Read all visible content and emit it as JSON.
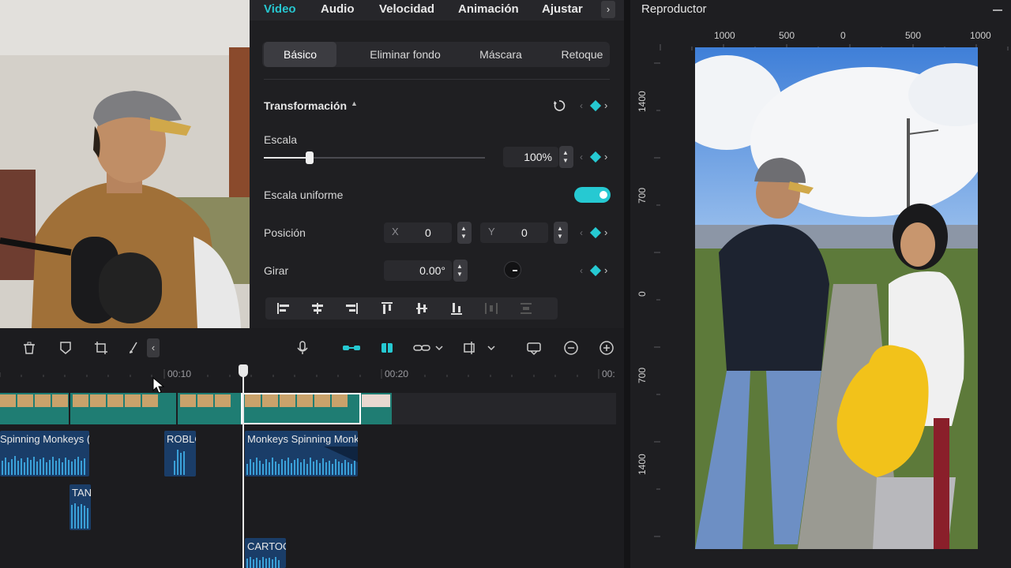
{
  "props": {
    "tabs": [
      "Video",
      "Audio",
      "Velocidad",
      "Animación",
      "Ajustar"
    ],
    "active_tab": "Video",
    "subtabs": [
      "Básico",
      "Eliminar fondo",
      "Máscara",
      "Retoque"
    ],
    "transform_title": "Transformación",
    "scale_label": "Escala",
    "scale_value": "100%",
    "uniform_label": "Escala uniforme",
    "position_label": "Posición",
    "pos_x_label": "X",
    "pos_x_value": "0",
    "pos_y_label": "Y",
    "pos_y_value": "0",
    "rotate_label": "Girar",
    "rotate_value": "0.00°",
    "accent_color": "#26c9d2"
  },
  "player": {
    "title": "Reproductor",
    "ruler_top": [
      "1000",
      "500",
      "0",
      "500",
      "1000"
    ],
    "ruler_left": [
      "1400",
      "700",
      "0",
      "700",
      "1400"
    ]
  },
  "timeline": {
    "timecodes": [
      "00:10",
      "00:20",
      "00:"
    ],
    "clips": [
      {
        "label": "Spinning Monkeys (I"
      },
      {
        "label": "ROBLO"
      },
      {
        "label": "Monkeys Spinning Monk"
      },
      {
        "label": "TAN"
      },
      {
        "label": "CARTOO"
      }
    ]
  }
}
